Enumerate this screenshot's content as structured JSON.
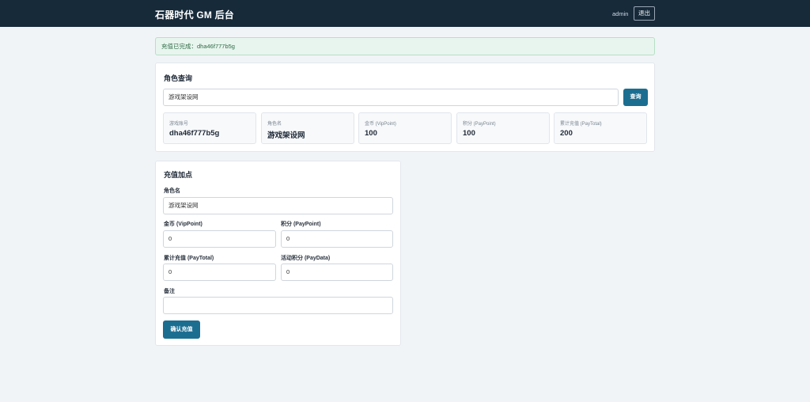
{
  "header": {
    "title": "石器时代 GM 后台",
    "user": "admin",
    "logout_label": "退出"
  },
  "alert": {
    "message": "充值已完成：dha46f777b5g"
  },
  "role_query": {
    "title": "角色查询",
    "search_value": "游戏架设网",
    "search_button": "查询",
    "stats": [
      {
        "label": "游戏账号",
        "value": "dha46f777b5g"
      },
      {
        "label": "角色名",
        "value": "游戏架设网"
      },
      {
        "label": "金币 (VipPoint)",
        "value": "100"
      },
      {
        "label": "积分 (PayPoint)",
        "value": "100"
      },
      {
        "label": "累计充值 (PayTotal)",
        "value": "200"
      }
    ]
  },
  "recharge": {
    "title": "充值加点",
    "role_label": "角色名",
    "role_value": "游戏架设网",
    "vip_label": "金币 (VipPoint)",
    "vip_value": "0",
    "pay_label": "积分 (PayPoint)",
    "pay_value": "0",
    "total_label": "累计充值 (PayTotal)",
    "total_value": "0",
    "paydata_label": "活动积分 (PayData)",
    "paydata_value": "0",
    "note_label": "备注",
    "note_value": "",
    "submit_label": "确认充值"
  }
}
